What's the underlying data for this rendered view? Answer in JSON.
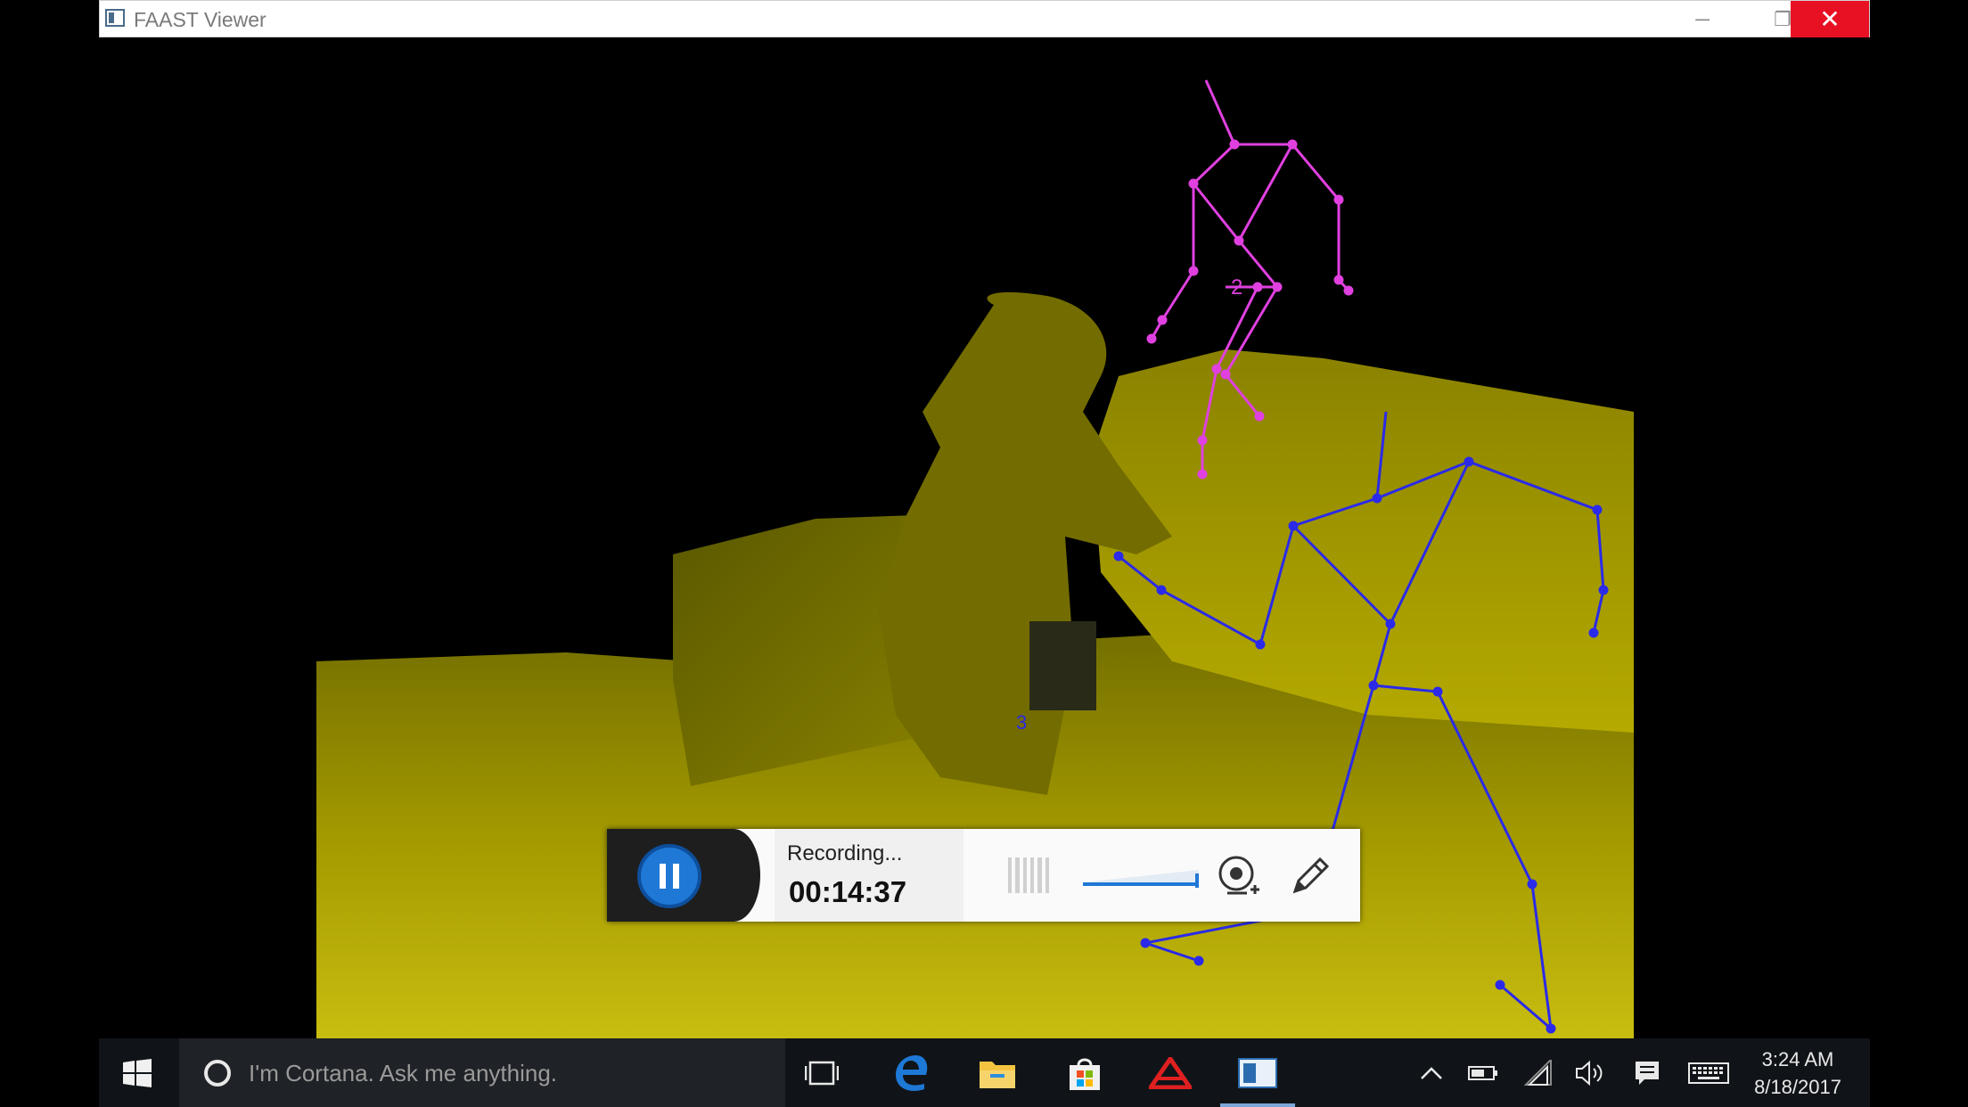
{
  "window": {
    "title": "FAAST Viewer",
    "minimize_glyph": "─",
    "restore_glyph": "❐",
    "close_glyph": "✕"
  },
  "viewer": {
    "skeleton_labels": [
      "2",
      "3"
    ],
    "colors": {
      "depth_yellow": "#b0a500",
      "skeleton_magenta": "#e040e0",
      "skeleton_blue": "#2a2ae8"
    }
  },
  "recorder": {
    "status": "Recording...",
    "time": "00:14:37",
    "pause_icon": "pause-icon",
    "webcam_icon": "webcam-add-icon",
    "pen_icon": "pen-icon",
    "accent": "#1f78d6"
  },
  "taskbar": {
    "search_placeholder": "I'm Cortana. Ask me anything.",
    "apps": [
      "task-view-icon",
      "edge-icon",
      "file-explorer-icon",
      "store-icon",
      "autodesk-icon",
      "faast-viewer-icon"
    ],
    "tray": [
      "chevron-up-icon",
      "battery-icon",
      "wifi-icon",
      "volume-icon",
      "notification-icon",
      "keyboard-icon"
    ],
    "time": "3:24 AM",
    "date": "8/18/2017"
  }
}
